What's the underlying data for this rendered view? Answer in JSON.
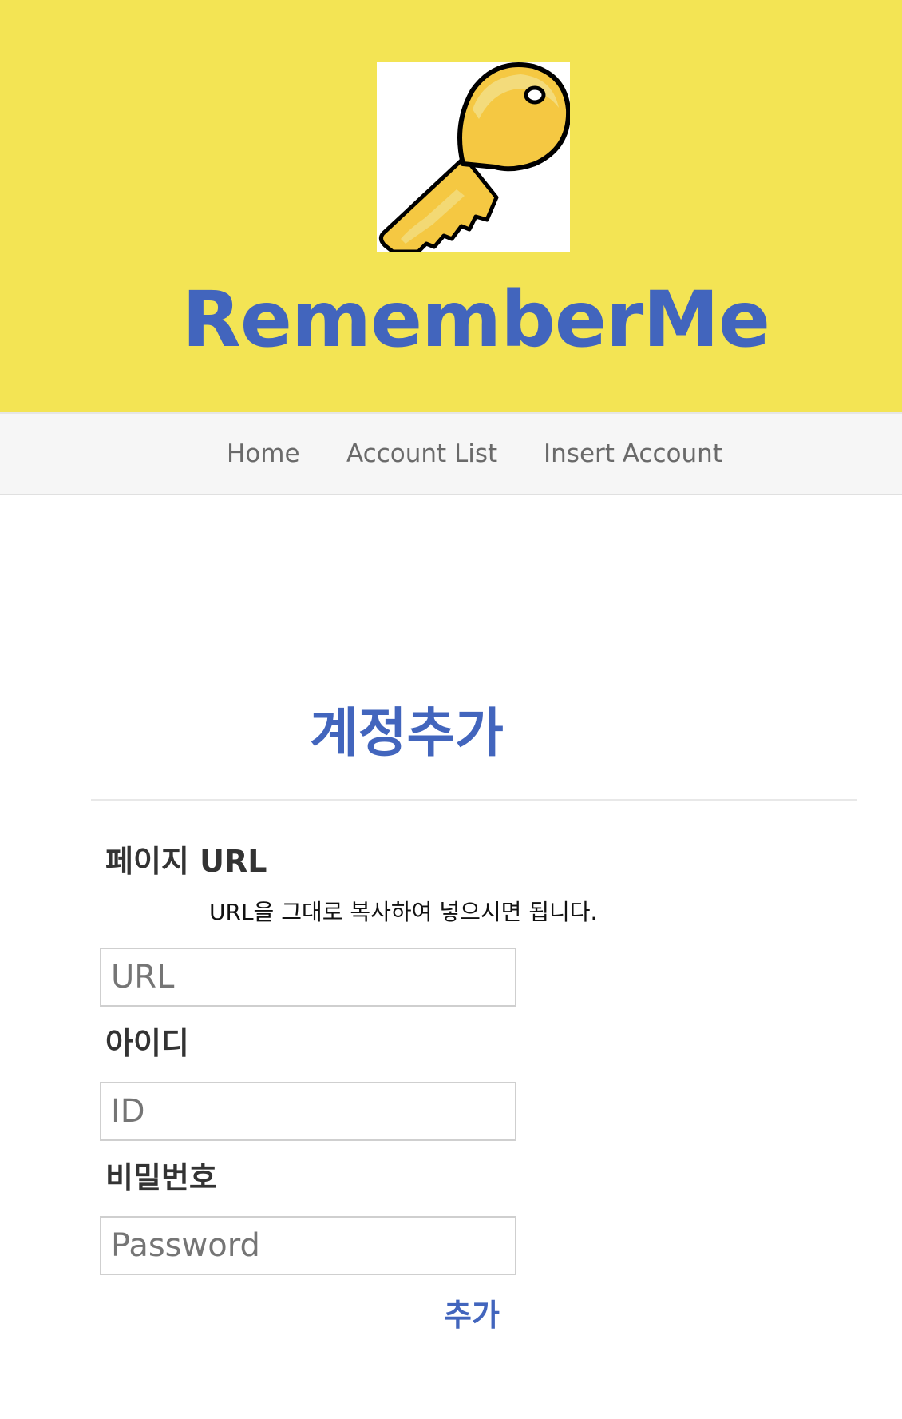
{
  "header": {
    "logo_icon": "key-icon",
    "brand": "RememberMe",
    "background_color": "#f3e454",
    "brand_color": "#4265bd"
  },
  "nav": {
    "items": [
      {
        "label": "Home"
      },
      {
        "label": "Account List"
      },
      {
        "label": "Insert Account"
      }
    ]
  },
  "form": {
    "title": "계정추가",
    "url_label": "페이지 URL",
    "url_hint": "URL을 그대로 복사하여 넣으시면 됩니다.",
    "url_placeholder": "URL",
    "id_label": "아이디",
    "id_placeholder": "ID",
    "password_label": "비밀번호",
    "password_placeholder": "Password",
    "submit_label": "추가"
  }
}
